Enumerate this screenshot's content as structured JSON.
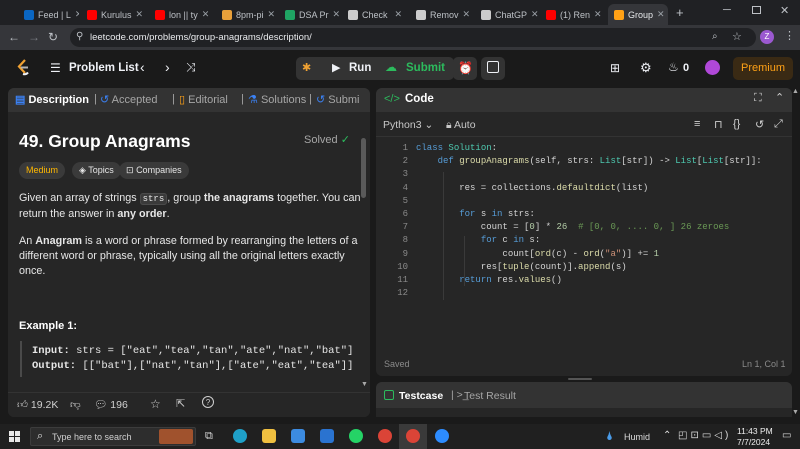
{
  "browser": {
    "tabs": [
      {
        "label": "Feed | L",
        "color": "#0a66c2"
      },
      {
        "label": "Kurulus",
        "color": "#ff0000"
      },
      {
        "label": "lon || ty",
        "color": "#ff0000"
      },
      {
        "label": "8pm-pi",
        "color": "#e8a03a"
      },
      {
        "label": "DSA Pr",
        "color": "#1fa463"
      },
      {
        "label": "Check",
        "color": "#cccccc"
      },
      {
        "label": "Remov",
        "color": "#cccccc"
      },
      {
        "label": "ChatGP",
        "color": "#cccccc"
      },
      {
        "label": "(1) Ren",
        "color": "#ff0000"
      },
      {
        "label": "Group",
        "color": "#ffa116",
        "active": true
      }
    ],
    "url": "leetcode.com/problems/group-anagrams/description/",
    "profile_initial": "Z"
  },
  "nav": {
    "problem_list": "Problem List",
    "run": "Run",
    "submit": "Submit",
    "streak": "0",
    "premium": "Premium"
  },
  "left": {
    "tabs": [
      "Description",
      "Accepted",
      "Editorial",
      "Solutions",
      "Submi"
    ],
    "title": "49. Group Anagrams",
    "solved": "Solved",
    "difficulty": "Medium",
    "topics": "Topics",
    "companies": "Companies",
    "p1": {
      "a": "Given an array of strings ",
      "code": "strs",
      "b": ", group ",
      "bold1": "the anagrams",
      "c": " together. You can return the answer in ",
      "bold2": "any order",
      "d": "."
    },
    "p2": {
      "bold": "Anagram",
      "rest": " is a word or phrase formed by rearranging the letters of a different word or phrase, typically using all the original letters exactly once.",
      "a": "An "
    },
    "example_title": "Example 1:",
    "input_label": "Input:",
    "input_value": "strs = [\"eat\",\"tea\",\"tan\",\"ate\",\"nat\",\"bat\"]",
    "output_label": "Output:",
    "output_value": "[[\"bat\"],[\"nat\",\"tan\"],[\"ate\",\"eat\",\"tea\"]]",
    "likes": "19.2K",
    "comments": "196"
  },
  "code": {
    "header": "Code",
    "language": "Python3",
    "mode": "Auto",
    "lines": [
      "class Solution:",
      "    def groupAnagrams(self, strs: List[str]) -> List[List[str]]:",
      "",
      "        res = collections.defaultdict(list)",
      "",
      "        for s in strs:",
      "            count = [0] * 26  # [0, 0, .... 0, ] 26 zeroes",
      "            for c in s:",
      "                count[ord(c) - ord(\"a\")] += 1",
      "            res[tuple(count)].append(s)",
      "        return res.values()",
      ""
    ],
    "status": "Saved",
    "cursor": "Ln 1, Col 1"
  },
  "bottom": {
    "testcase": "Testcase",
    "result": "Test Result"
  },
  "taskbar": {
    "search": "Type here to search",
    "weather": "Humid",
    "time": "11:43 PM",
    "date": "7/7/2024"
  }
}
